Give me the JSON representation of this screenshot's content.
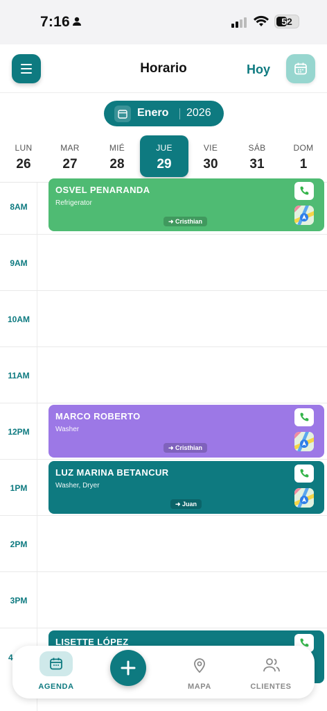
{
  "status_bar": {
    "time": "7:16",
    "battery": "52"
  },
  "header": {
    "title": "Horario",
    "today_label": "Hoy"
  },
  "month_picker": {
    "month": "Enero",
    "year": "2026"
  },
  "week": [
    {
      "name": "LUN",
      "date": "26"
    },
    {
      "name": "MAR",
      "date": "27"
    },
    {
      "name": "MIÉ",
      "date": "28"
    },
    {
      "name": "JUE",
      "date": "29",
      "selected": true
    },
    {
      "name": "VIE",
      "date": "30"
    },
    {
      "name": "SÁB",
      "date": "31"
    },
    {
      "name": "DOM",
      "date": "1"
    }
  ],
  "hours": [
    "8AM",
    "9AM",
    "10AM",
    "11AM",
    "12PM",
    "1PM",
    "2PM",
    "3PM",
    "4"
  ],
  "events": [
    {
      "name": "OSVEL PENARANDA",
      "appliance": "Refrigerator",
      "tech": "➜ Cristhian",
      "color": "#4fbb73"
    },
    {
      "name": "MARCO ROBERTO",
      "appliance": "Washer",
      "tech": "➜ Cristhian",
      "color": "#9c78e6"
    },
    {
      "name": "LUZ MARINA BETANCUR",
      "appliance": "Washer, Dryer",
      "tech": "➜ Juan",
      "color": "#0e7a80"
    },
    {
      "name": "LISETTE LÓPEZ",
      "appliance": "",
      "tech": "",
      "color": "#0e7a80"
    }
  ],
  "nav": {
    "agenda": "AGENDA",
    "mapa": "MAPA",
    "clientes": "CLIENTES"
  },
  "colors": {
    "accent": "#0e7a80",
    "accent_light": "#97d6cf"
  }
}
